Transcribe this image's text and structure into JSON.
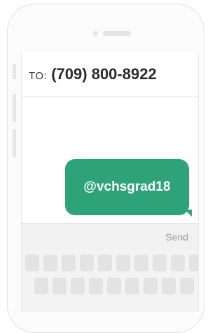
{
  "message": {
    "to_label": "TO:",
    "recipient": "(709) 800-8922",
    "bubble_text": "@vchsgrad18",
    "send_label": "Send"
  },
  "colors": {
    "bubble": "#2ea37a",
    "send_text": "#9a9a9a"
  },
  "icons": [
    "camera-icon",
    "speaker-grille"
  ],
  "keyboard": {
    "row_count": 2
  }
}
